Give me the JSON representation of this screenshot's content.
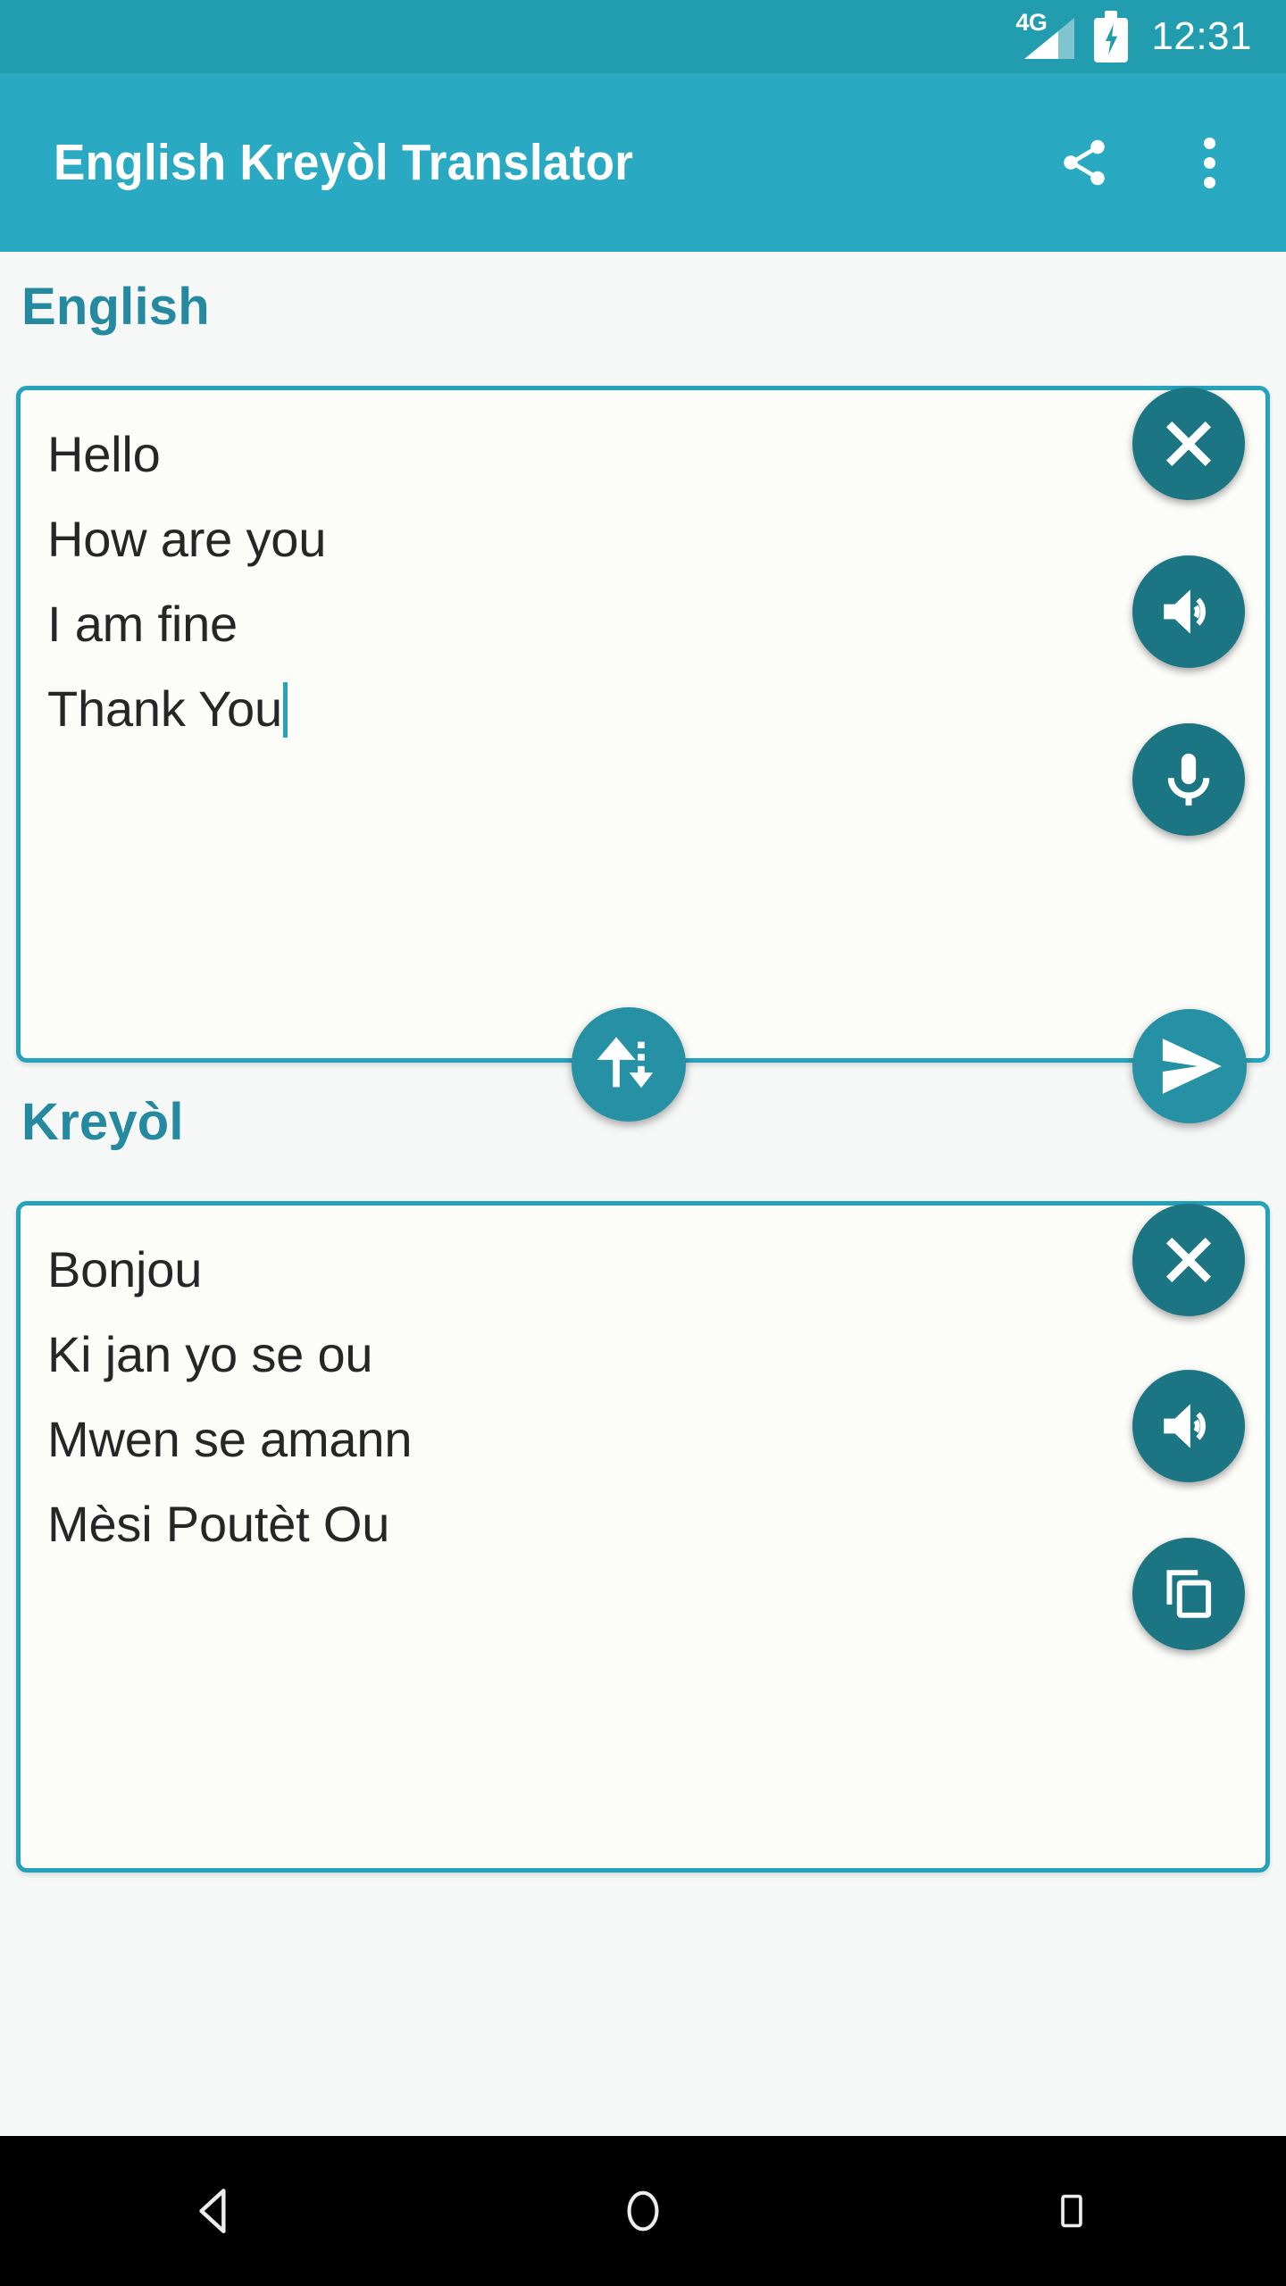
{
  "status_bar": {
    "network_label": "4G",
    "time": "12:31",
    "signal_icon": "signal-cellular-icon",
    "battery_icon": "battery-charging-icon"
  },
  "app_bar": {
    "title": "English Kreyòl Translator",
    "share_icon": "share-icon",
    "overflow_icon": "overflow-menu-icon"
  },
  "source": {
    "language_label": "English",
    "text": "Hello\nHow are you\nI am fine\nThank You",
    "clear_label": "clear-icon",
    "speak_label": "volume-up-icon",
    "mic_label": "microphone-icon"
  },
  "target": {
    "language_label": "Kreyòl",
    "text": "Bonjou\nKi jan yo se ou\nMwen se amann\nMèsi Poutèt Ou",
    "clear_label": "clear-icon",
    "speak_label": "volume-up-icon",
    "copy_label": "copy-icon"
  },
  "actions": {
    "swap_icon": "swap-vertical-icon",
    "send_icon": "send-icon"
  },
  "nav_bar": {
    "back_icon": "back-triangle-icon",
    "home_icon": "home-circle-icon",
    "recents_icon": "recents-square-icon"
  },
  "colors": {
    "status_bar": "#229CAF",
    "app_bar": "#29AAC2",
    "accent": "#26A3BC",
    "label_teal": "#2589A0",
    "fab_dark": "#1C7583",
    "fab_light": "#2690A4",
    "page_background": "#F6F8F8",
    "panel_background": "#FCFCF9",
    "text": "#262626",
    "nav_bar": "#000000"
  }
}
